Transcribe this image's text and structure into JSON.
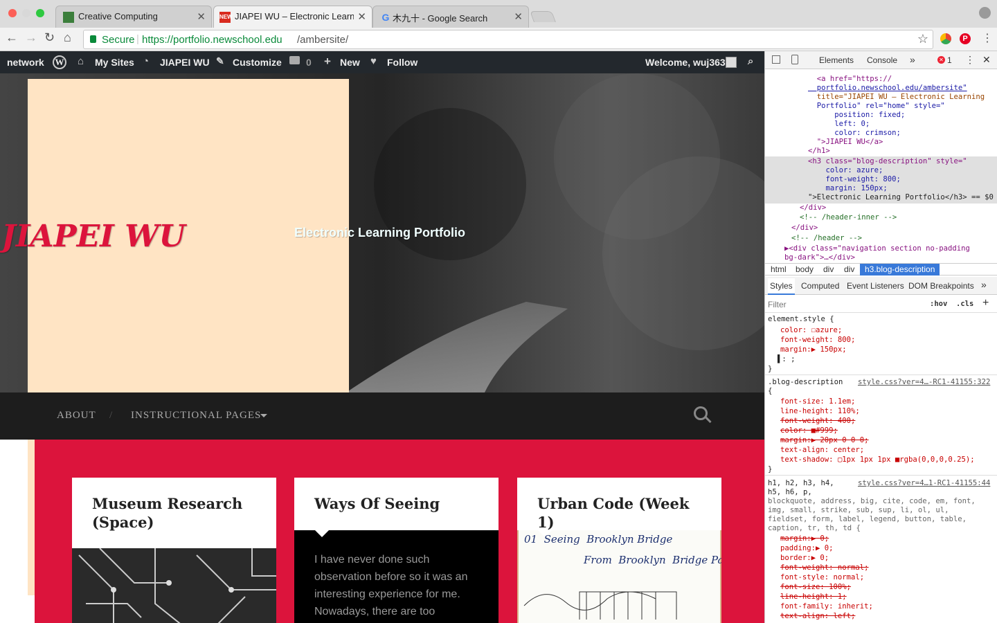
{
  "browser": {
    "tabs": [
      {
        "title": "Creative Computing",
        "favicon": "green-square-icon",
        "active": false
      },
      {
        "title": "JIAPEI WU – Electronic Learnin",
        "favicon": "new-badge-icon",
        "active": true
      },
      {
        "title": "木九十 - Google Search",
        "favicon": "google-g-icon",
        "active": false
      }
    ],
    "secure_label": "Secure",
    "url_host": "https://portfolio.newschool.edu",
    "url_path": "/ambersite/"
  },
  "adminbar": {
    "network": "network",
    "my_sites": "My Sites",
    "site_name": "JIAPEI WU",
    "customize": "Customize",
    "comments_count": "0",
    "new": "New",
    "follow": "Follow",
    "welcome": "Welcome, wuj363"
  },
  "site": {
    "title": "JIAPEI WU",
    "description": "Electronic Learning Portfolio",
    "title_color": "#dc143c",
    "panel_color": "#ffe4c4",
    "accent": "#dc143c"
  },
  "nav": {
    "items": [
      "ABOUT",
      "INSTRUCTIONAL PAGES"
    ],
    "separator": "/"
  },
  "posts": [
    {
      "title": "Museum Research (Space)",
      "media": "circuit-photo"
    },
    {
      "title": "Ways Of Seeing",
      "excerpt": "I have never done such observation before so it was an interesting experience for me. Nowadays, there are too"
    },
    {
      "title": "Urban Code (Week 1)",
      "media_text_1": "01  Seeing  Brooklyn Bridge",
      "media_text_2": "From  Brooklyn  Bridge Park"
    }
  ],
  "devtools": {
    "tabs": [
      "Elements",
      "Console"
    ],
    "error_count": "1",
    "breadcrumbs": [
      "html",
      "body",
      "div",
      "div",
      "h3.blog-description"
    ],
    "panel_tabs": [
      "Styles",
      "Computed",
      "Event Listeners",
      "DOM Breakpoints"
    ],
    "filter_placeholder": "Filter",
    "hov": ":hov",
    "cls": ".cls",
    "dom_lines": [
      "  <a href=\"https://",
      "  portfolio.newschool.edu/ambersite\"",
      "  title=\"JIAPEI WU – Electronic Learning",
      "  Portfolio\" rel=\"home\" style=\"",
      "      position: fixed;",
      "      left: 0;",
      "      color: crimson;",
      "  \">JIAPEI WU</a>",
      "</h1>",
      "<h3 class=\"blog-description\" style=\"",
      "    color: azure;",
      "    font-weight: 800;",
      "    margin: 150px;",
      "\">Electronic Learning Portfolio</h3> == $0",
      "</div>",
      "<!-- /header-inner -->",
      "</div>",
      "<!-- /header -->",
      "▶<div class=\"navigation section no-padding",
      "bg-dark\">…</div>"
    ],
    "element_style": {
      "selector": "element.style {",
      "rules": [
        "color: ☐azure;",
        "font-weight: 800;",
        "margin:▶ 150px;",
        "▌: ;"
      ]
    },
    "blog_desc": {
      "selector": ".blog-description",
      "source": "style.css?ver=4…-RC1-41155:322",
      "rules": [
        "font-size: 1.1em;",
        "line-height: 110%;",
        "font-weight: 400;",
        "color: ■#999;",
        "margin:▶ 20px 0 0 0;",
        "text-align: center;",
        "text-shadow: ▢1px 1px 1px ■rgba(0,0,0,0.25);"
      ]
    },
    "reset": {
      "selector_lines": [
        "h1, h2, h3, h4,",
        "h5, h6, p,",
        "blockquote, address, big, cite, code, em, font,",
        "img, small, strike, sub, sup, li, ol, ul,",
        "fieldset, form, label, legend, button, table,",
        "caption, tr, th, td {"
      ],
      "source": "style.css?ver=4…1-RC1-41155:44",
      "rules": [
        "margin:▶ 0;",
        "padding:▶ 0;",
        "border:▶ 0;",
        "font-weight: normal;",
        "font-style: normal;",
        "font-size: 100%;",
        "line-height: 1;",
        "font-family: inherit;",
        "text-align: left;"
      ]
    }
  }
}
